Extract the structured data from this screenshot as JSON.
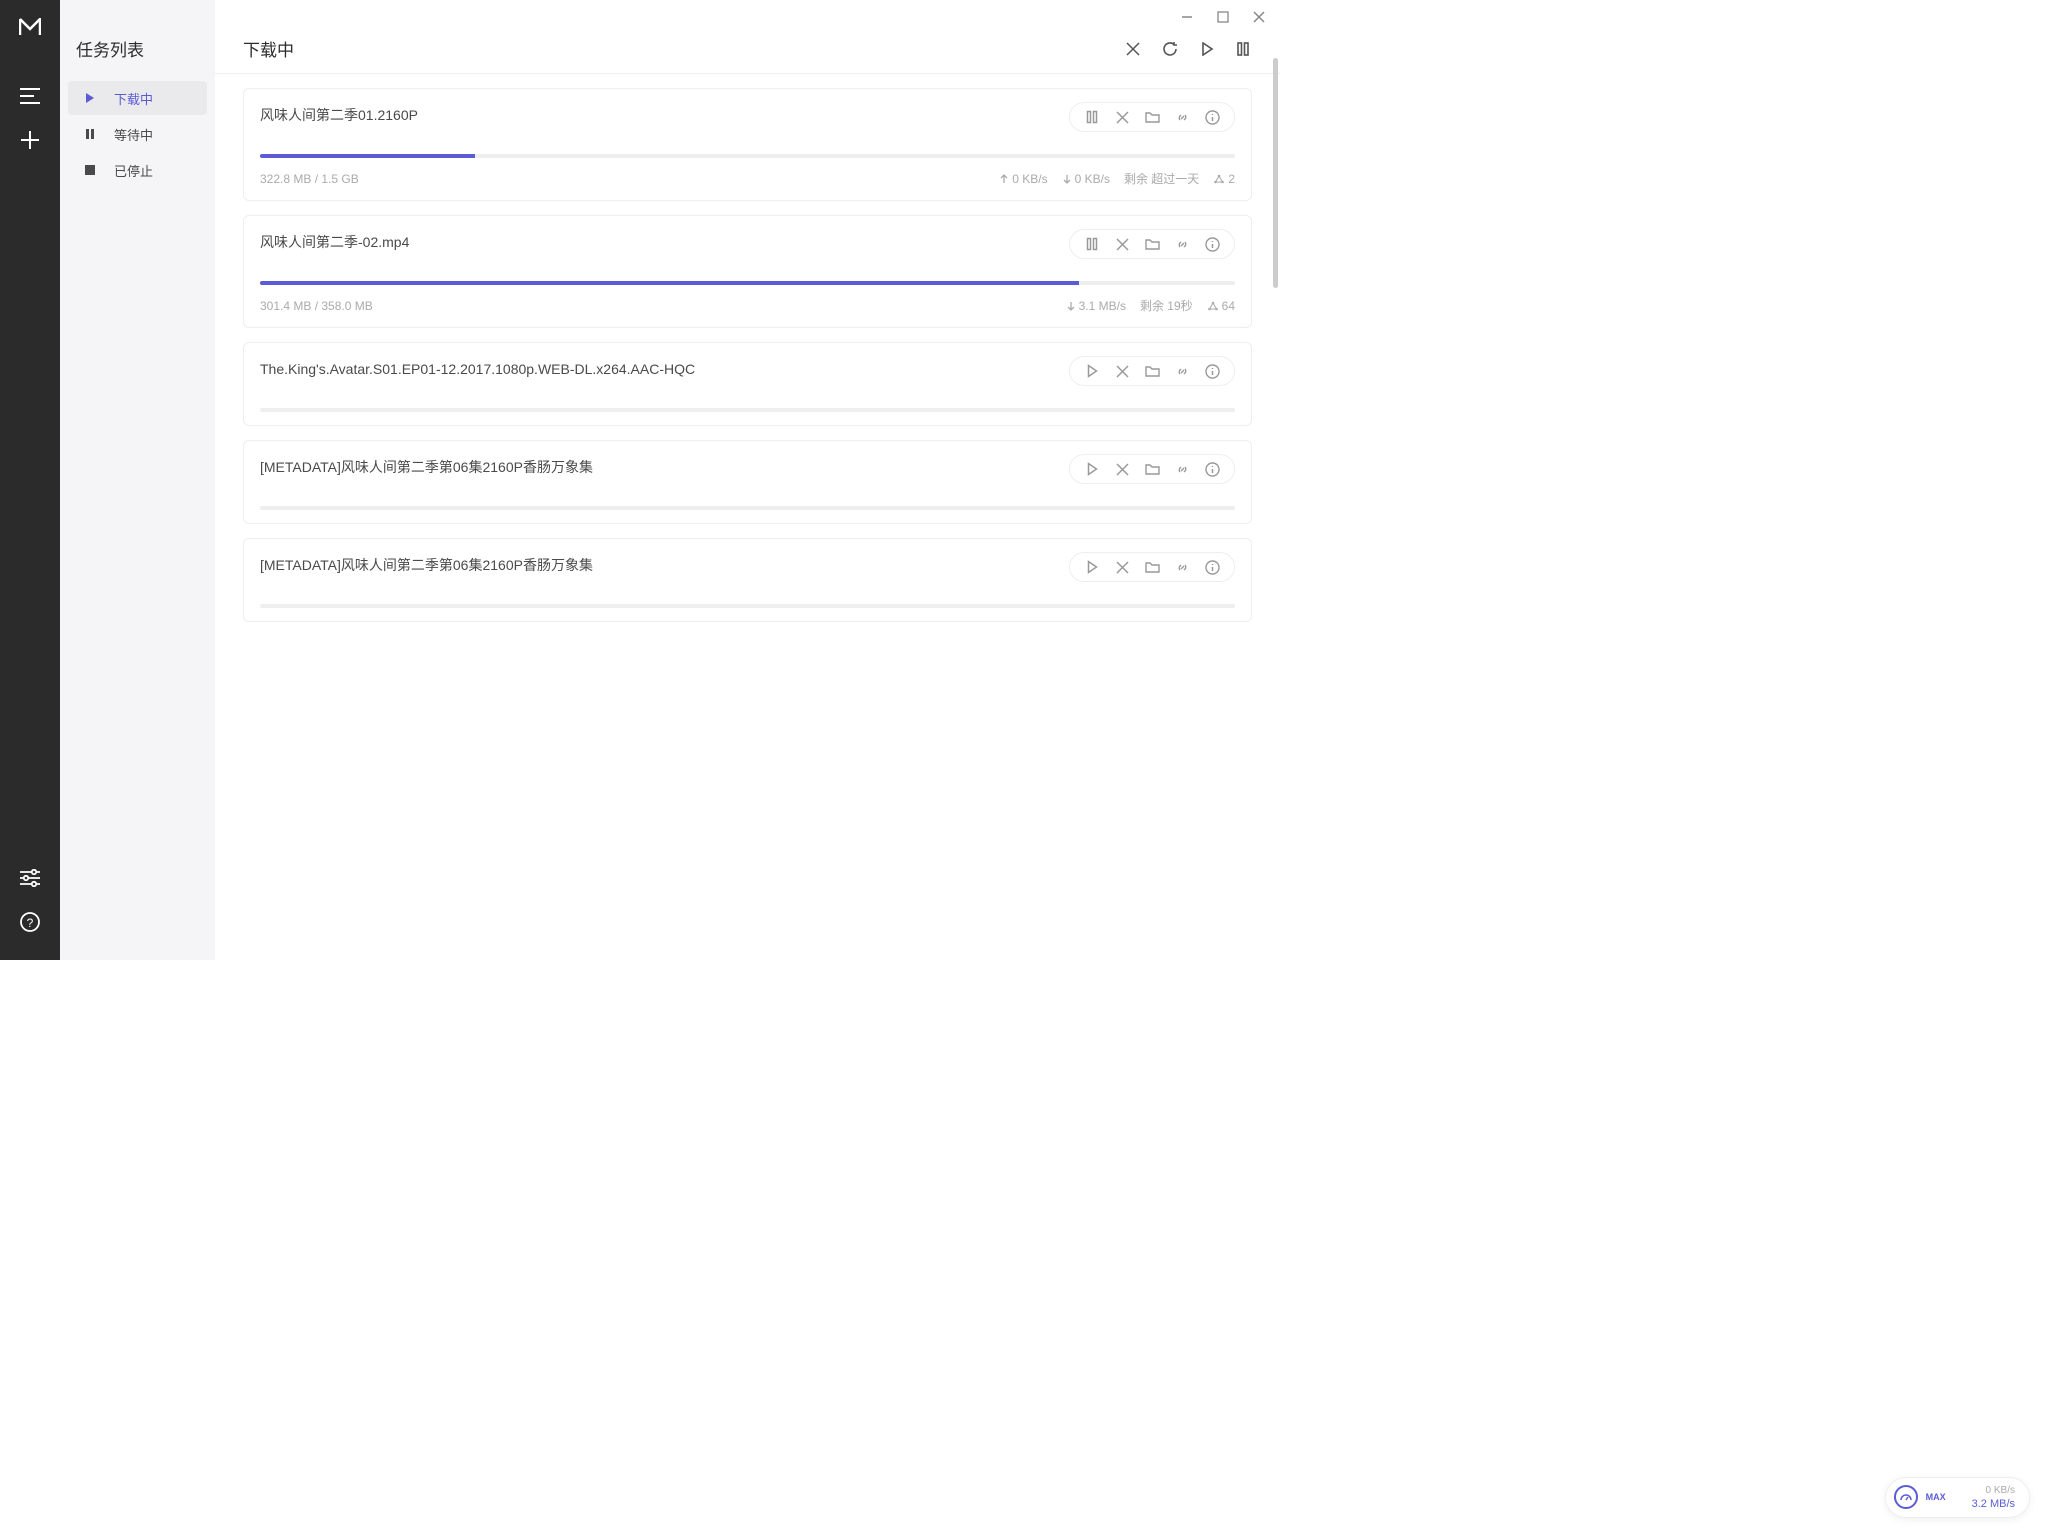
{
  "sidebar": {
    "title": "任务列表",
    "items": [
      {
        "label": "下载中"
      },
      {
        "label": "等待中"
      },
      {
        "label": "已停止"
      }
    ]
  },
  "page": {
    "title": "下载中"
  },
  "tasks": [
    {
      "name": "风味人间第二季01.2160P",
      "showPause": true,
      "progress": 22,
      "size": "322.8 MB / 1.5 GB",
      "up": "0 KB/s",
      "down": "0 KB/s",
      "remain": "剩余 超过一天",
      "peers": "2"
    },
    {
      "name": "风味人间第二季-02.mp4",
      "showPause": true,
      "progress": 84,
      "size": "301.4 MB / 358.0 MB",
      "up": "",
      "down": "3.1 MB/s",
      "remain": "剩余 19秒",
      "peers": "64"
    },
    {
      "name": "The.King's.Avatar.S01.EP01-12.2017.1080p.WEB-DL.x264.AAC-HQC",
      "showPause": false,
      "progress": 0,
      "size": "",
      "up": "",
      "down": "",
      "remain": "",
      "peers": ""
    },
    {
      "name": "[METADATA]风味人间第二季第06集2160P香肠万象集",
      "showPause": false,
      "progress": 0,
      "size": "",
      "up": "",
      "down": "",
      "remain": "",
      "peers": ""
    },
    {
      "name": "[METADATA]风味人间第二季第06集2160P香肠万象集",
      "showPause": false,
      "progress": 0,
      "size": "",
      "up": "",
      "down": "",
      "remain": "",
      "peers": ""
    }
  ],
  "speedWidget": {
    "label": "MAX",
    "up": "0 KB/s",
    "down": "3.2 MB/s"
  }
}
